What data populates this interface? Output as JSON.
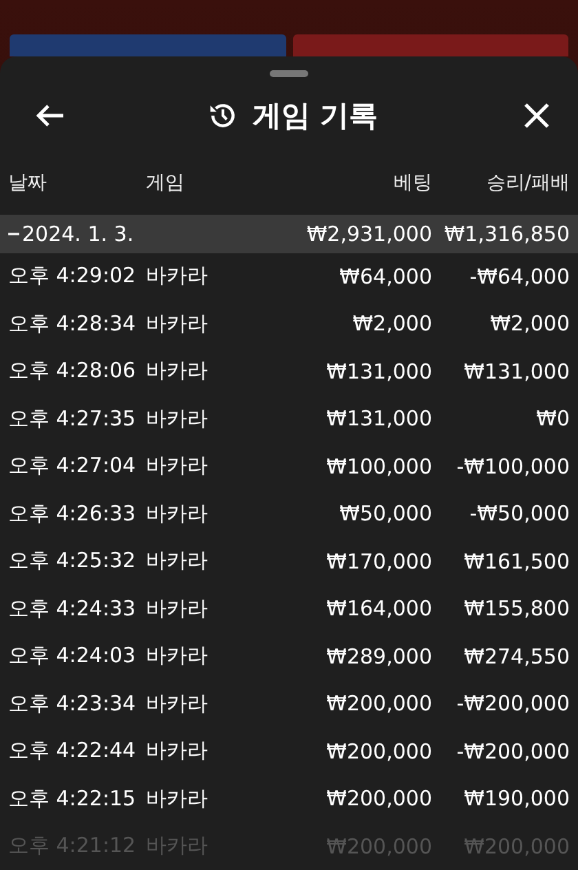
{
  "sheet": {
    "title": "게임 기록"
  },
  "columns": [
    "날짜",
    "게임",
    "베팅",
    "승리/패배"
  ],
  "group": {
    "date": "2024. 1. 3.",
    "expanded": true,
    "bet": "₩2,931,000",
    "result": "₩1,316,850"
  },
  "rows": [
    {
      "time": "오후 4:29:02",
      "game": "바카라",
      "bet": "₩64,000",
      "result": "-₩64,000",
      "faded": false
    },
    {
      "time": "오후 4:28:34",
      "game": "바카라",
      "bet": "₩2,000",
      "result": "₩2,000",
      "faded": false
    },
    {
      "time": "오후 4:28:06",
      "game": "바카라",
      "bet": "₩131,000",
      "result": "₩131,000",
      "faded": false
    },
    {
      "time": "오후 4:27:35",
      "game": "바카라",
      "bet": "₩131,000",
      "result": "₩0",
      "faded": false
    },
    {
      "time": "오후 4:27:04",
      "game": "바카라",
      "bet": "₩100,000",
      "result": "-₩100,000",
      "faded": false
    },
    {
      "time": "오후 4:26:33",
      "game": "바카라",
      "bet": "₩50,000",
      "result": "-₩50,000",
      "faded": false
    },
    {
      "time": "오후 4:25:32",
      "game": "바카라",
      "bet": "₩170,000",
      "result": "₩161,500",
      "faded": false
    },
    {
      "time": "오후 4:24:33",
      "game": "바카라",
      "bet": "₩164,000",
      "result": "₩155,800",
      "faded": false
    },
    {
      "time": "오후 4:24:03",
      "game": "바카라",
      "bet": "₩289,000",
      "result": "₩274,550",
      "faded": false
    },
    {
      "time": "오후 4:23:34",
      "game": "바카라",
      "bet": "₩200,000",
      "result": "-₩200,000",
      "faded": false
    },
    {
      "time": "오후 4:22:44",
      "game": "바카라",
      "bet": "₩200,000",
      "result": "-₩200,000",
      "faded": false
    },
    {
      "time": "오후 4:22:15",
      "game": "바카라",
      "bet": "₩200,000",
      "result": "₩190,000",
      "faded": false
    },
    {
      "time": "오후 4:21:12",
      "game": "바카라",
      "bet": "₩200,000",
      "result": "₩200,000",
      "faded": true
    }
  ]
}
